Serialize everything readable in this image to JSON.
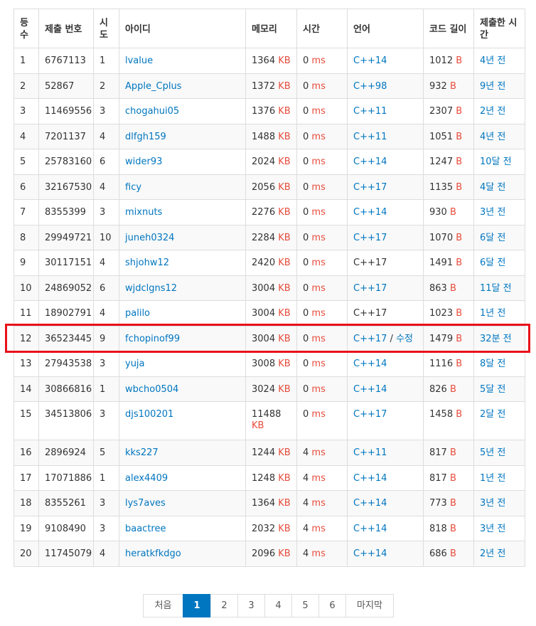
{
  "table": {
    "headers": {
      "rank": "등수",
      "submission": "제출 번호",
      "attempts": "시도",
      "user": "아이디",
      "memory": "메모리",
      "time": "시간",
      "language": "언어",
      "code_length": "코드 길이",
      "submitted": "제출한 시간"
    },
    "units": {
      "memory": "KB",
      "time": "ms",
      "length": "B"
    },
    "edit_label": "수정",
    "rows": [
      {
        "rank": "1",
        "id": "6767113",
        "tries": "1",
        "user": "lvalue",
        "mem": "1364",
        "time": "0",
        "lang": "C++14",
        "len": "1012",
        "ago": "4년 전"
      },
      {
        "rank": "2",
        "id": "52867",
        "tries": "2",
        "user": "Apple_Cplus",
        "mem": "1372",
        "time": "0",
        "lang": "C++98",
        "len": "932",
        "ago": "9년 전"
      },
      {
        "rank": "3",
        "id": "11469556",
        "tries": "3",
        "user": "chogahui05",
        "mem": "1376",
        "time": "0",
        "lang": "C++11",
        "len": "2307",
        "ago": "2년 전"
      },
      {
        "rank": "4",
        "id": "7201137",
        "tries": "4",
        "user": "dlfgh159",
        "mem": "1488",
        "time": "0",
        "lang": "C++11",
        "len": "1051",
        "ago": "4년 전"
      },
      {
        "rank": "5",
        "id": "25783160",
        "tries": "6",
        "user": "wider93",
        "mem": "2024",
        "time": "0",
        "lang": "C++14",
        "len": "1247",
        "ago": "10달 전"
      },
      {
        "rank": "6",
        "id": "32167530",
        "tries": "4",
        "user": "ficy",
        "mem": "2056",
        "time": "0",
        "lang": "C++17",
        "len": "1135",
        "ago": "4달 전"
      },
      {
        "rank": "7",
        "id": "8355399",
        "tries": "3",
        "user": "mixnuts",
        "mem": "2276",
        "time": "0",
        "lang": "C++14",
        "len": "930",
        "ago": "3년 전"
      },
      {
        "rank": "8",
        "id": "29949721",
        "tries": "10",
        "user": "juneh0324",
        "mem": "2284",
        "time": "0",
        "lang": "C++17",
        "len": "1070",
        "ago": "6달 전"
      },
      {
        "rank": "9",
        "id": "30117151",
        "tries": "4",
        "user": "shjohw12",
        "mem": "2420",
        "time": "0",
        "lang": "C++17",
        "lang_plain": true,
        "len": "1491",
        "ago": "6달 전"
      },
      {
        "rank": "10",
        "id": "24869052",
        "tries": "6",
        "user": "wjdclgns12",
        "mem": "3004",
        "time": "0",
        "lang": "C++17",
        "len": "863",
        "ago": "11달 전"
      },
      {
        "rank": "11",
        "id": "18902791",
        "tries": "4",
        "user": "palilo",
        "mem": "3004",
        "time": "0",
        "lang": "C++17",
        "lang_plain": true,
        "len": "1023",
        "ago": "1년 전"
      },
      {
        "rank": "12",
        "id": "36523445",
        "tries": "9",
        "user": "fchopinof99",
        "mem": "3004",
        "time": "0",
        "lang": "C++17",
        "edit": true,
        "len": "1479",
        "ago": "32분 전"
      },
      {
        "rank": "13",
        "id": "27943538",
        "tries": "3",
        "user": "yuja",
        "mem": "3008",
        "time": "0",
        "lang": "C++14",
        "len": "1116",
        "ago": "8달 전"
      },
      {
        "rank": "14",
        "id": "30866816",
        "tries": "1",
        "user": "wbcho0504",
        "mem": "3024",
        "time": "0",
        "lang": "C++14",
        "len": "826",
        "ago": "5달 전"
      },
      {
        "rank": "15",
        "id": "34513806",
        "tries": "3",
        "user": "djs100201",
        "mem": "11488",
        "time": "0",
        "lang": "C++17",
        "len": "1458",
        "ago": "2달 전",
        "tall": true
      },
      {
        "rank": "16",
        "id": "2896924",
        "tries": "5",
        "user": "kks227",
        "mem": "1244",
        "time": "4",
        "lang": "C++11",
        "len": "817",
        "ago": "5년 전"
      },
      {
        "rank": "17",
        "id": "17071886",
        "tries": "1",
        "user": "alex4409",
        "mem": "1248",
        "time": "4",
        "lang": "C++14",
        "len": "817",
        "ago": "1년 전"
      },
      {
        "rank": "18",
        "id": "8355261",
        "tries": "3",
        "user": "lys7aves",
        "mem": "1364",
        "time": "4",
        "lang": "C++14",
        "len": "773",
        "ago": "3년 전"
      },
      {
        "rank": "19",
        "id": "9108490",
        "tries": "3",
        "user": "baactree",
        "mem": "2032",
        "time": "4",
        "lang": "C++14",
        "len": "818",
        "ago": "3년 전"
      },
      {
        "rank": "20",
        "id": "11745079",
        "tries": "4",
        "user": "heratkfkdgo",
        "mem": "2096",
        "time": "4",
        "lang": "C++14",
        "len": "686",
        "ago": "2년 전"
      }
    ]
  },
  "highlighted_rank": "12",
  "pagination": {
    "first": "처음",
    "pages": [
      "1",
      "2",
      "3",
      "4",
      "5",
      "6"
    ],
    "active": "1",
    "last": "마지막"
  },
  "colors": {
    "link": "#0076c0",
    "unit": "#e74c3c",
    "highlight": "#e8111a",
    "active_page": "#0076c0"
  }
}
